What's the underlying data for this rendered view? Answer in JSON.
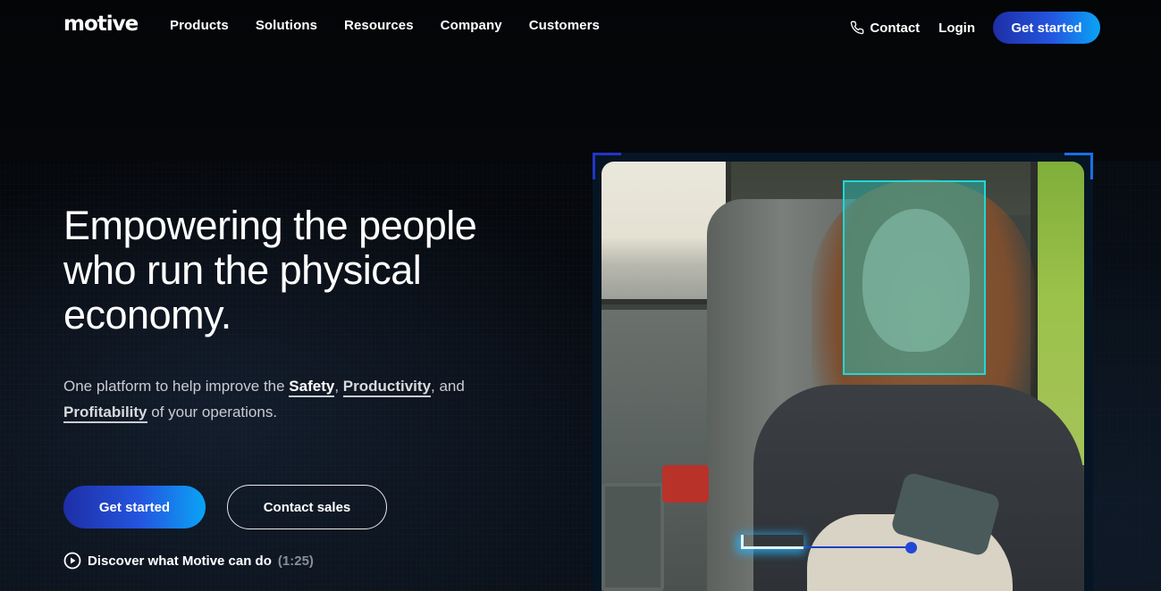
{
  "brand": {
    "logo_text": "motive",
    "accent_gradient": [
      "#1e2ea6",
      "#2456e0",
      "#0aa4f5"
    ]
  },
  "nav": {
    "links": [
      {
        "label": "Products"
      },
      {
        "label": "Solutions"
      },
      {
        "label": "Resources"
      },
      {
        "label": "Company"
      },
      {
        "label": "Customers"
      }
    ],
    "contact": {
      "label": "Contact",
      "icon": "phone-icon"
    },
    "login_label": "Login",
    "cta_label": "Get started"
  },
  "hero": {
    "title": "Empowering the people who run the physical economy.",
    "subtitle": {
      "prefix": "One platform to help improve the ",
      "highlight_1": "Safety",
      "sep_1": ", ",
      "highlight_2": "Productivity",
      "sep_2": ", and ",
      "highlight_3": "Profitability",
      "suffix": " of your operations."
    },
    "primary_cta": "Get started",
    "secondary_cta": "Contact sales",
    "video_link": {
      "label": "Discover what Motive can do",
      "duration": "(1:25)",
      "icon": "play-circle-icon"
    }
  },
  "media": {
    "description": "Dashcam video of driver with face detection box and phone-use detection marker",
    "face_box_color": "#1fd8d8",
    "phone_marker_color": "#2147d8"
  }
}
